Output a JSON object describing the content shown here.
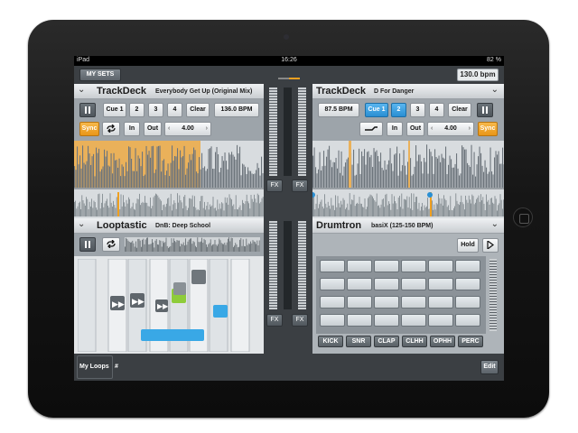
{
  "status": {
    "carrier": "iPad",
    "time": "16:26",
    "battery": "82 %"
  },
  "topbar": {
    "my_sets": "MY SETS",
    "bpm": "130.0 bpm"
  },
  "deck_left": {
    "title": "TrackDeck",
    "track": "Everybody Get Up (Original Mix)",
    "pause_icon": "pause-icon",
    "cues": [
      "Cue 1",
      "2",
      "3",
      "4"
    ],
    "clear": "Clear",
    "bpm": "136.0 BPM",
    "sync": "Sync",
    "loop_icon": "loop-icon",
    "in": "In",
    "out": "Out",
    "loop_len": "4.00"
  },
  "deck_right": {
    "title": "TrackDeck",
    "track": "D For Danger",
    "bpm": "87.5 BPM",
    "cues": [
      "Cue 1",
      "2",
      "3",
      "4"
    ],
    "clear": "Clear",
    "sync": "Sync",
    "in": "In",
    "out": "Out",
    "loop_len": "4.00"
  },
  "looptastic": {
    "title": "Looptastic",
    "sub": "DnB: Deep School"
  },
  "drumtron": {
    "title": "Drumtron",
    "sub": "basiX (125-150 BPM)",
    "hold": "Hold",
    "labels": [
      "KICK",
      "SNR",
      "CLAP",
      "CLHH",
      "OPHH",
      "PERC"
    ]
  },
  "mixer": {
    "fx": "FX"
  },
  "bottom": {
    "my_loops": "My Loops",
    "edit": "Edit"
  },
  "colors": {
    "accent_blue": "#2a8fd3",
    "accent_orange": "#e99618",
    "waveform_orange": "#f0b048",
    "dark_panel": "#3b3f43"
  }
}
